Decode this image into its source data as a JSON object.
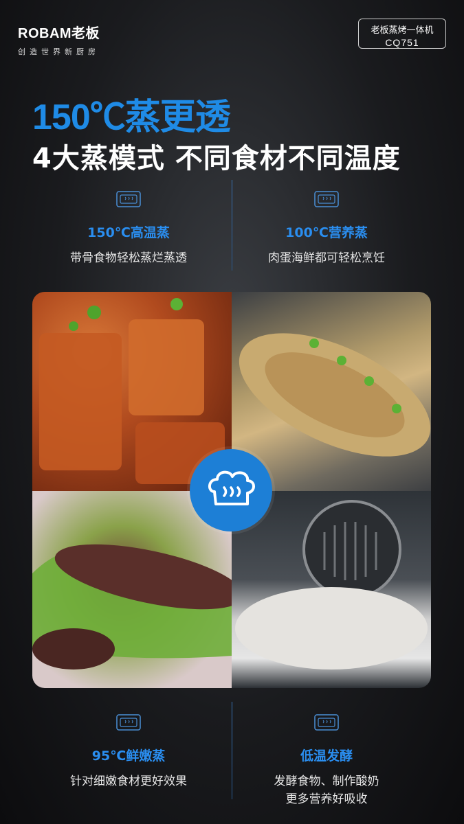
{
  "brand": {
    "logo": "ROBAM老板",
    "slogan": "创造世界新厨房"
  },
  "model": {
    "name": "老板蒸烤一体机",
    "code": "CQ751"
  },
  "headline": "150℃蒸更透",
  "subheadline": "4大蒸模式 不同食材不同温度",
  "colors": {
    "accent": "#1f8be6",
    "background": "#1c1d20"
  },
  "features": [
    {
      "title": "150℃高温蒸",
      "desc": "带骨食物轻松蒸烂蒸透",
      "icon": "steam-oven-icon"
    },
    {
      "title": "100℃营养蒸",
      "desc": "肉蛋海鲜都可轻松烹饪",
      "icon": "steam-oven-icon"
    },
    {
      "title": "95℃鲜嫩蒸",
      "desc": "针对细嫩食材更好效果",
      "icon": "steam-oven-icon"
    },
    {
      "title": "低温发酵",
      "desc_lines": [
        "发酵食物、制作酸奶",
        "更多营养好吸收"
      ],
      "icon": "steam-oven-icon"
    }
  ],
  "center_icon": "chef-hat-steam-icon"
}
